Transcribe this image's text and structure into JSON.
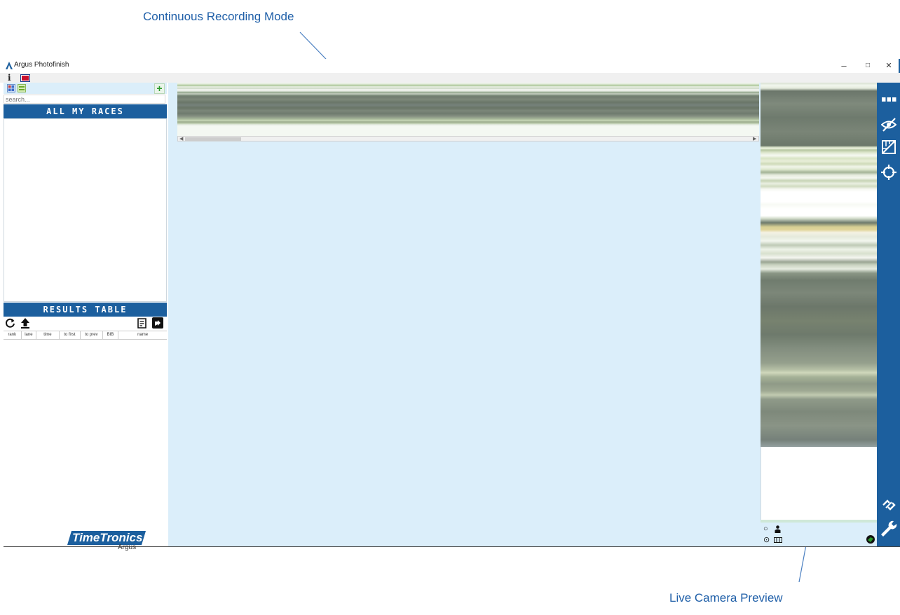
{
  "annotations": {
    "top_callout": "Continuous Recording Mode",
    "bottom_callout": "Live Camera Preview"
  },
  "window": {
    "title": "Argus Photofinish",
    "controls": {
      "minimize": "–",
      "restore": "□",
      "close": "✕"
    }
  },
  "menubar": {
    "info": "i"
  },
  "left_panel": {
    "search": {
      "placeholder": "search...",
      "value": ""
    },
    "races_header": "ALL MY RACES",
    "results_header": "RESULTS TABLE",
    "results_columns": [
      "rank",
      "lane",
      "time",
      "to first",
      "to prev",
      "BIB",
      "name"
    ],
    "logo": {
      "brand": "TimeTronics",
      "product": "Argus"
    }
  },
  "colors": {
    "accent": "#1c5f9e",
    "workspace": "#dbeefa",
    "callout": "#1f5fa8",
    "status_ok": "#2a9a2a"
  },
  "icons": {
    "sidebar": [
      "dots-menu-icon",
      "hide-icon",
      "crop-frame-icon",
      "crosshair-icon",
      "unlink-icon",
      "wrench-icon"
    ],
    "results_toolbar": [
      "refresh-icon",
      "upload-icon",
      "document-icon",
      "export-icon"
    ],
    "preview_controls": [
      "record-circle-icon",
      "person-icon",
      "target-icon",
      "film-icon",
      "plug-icon"
    ]
  }
}
